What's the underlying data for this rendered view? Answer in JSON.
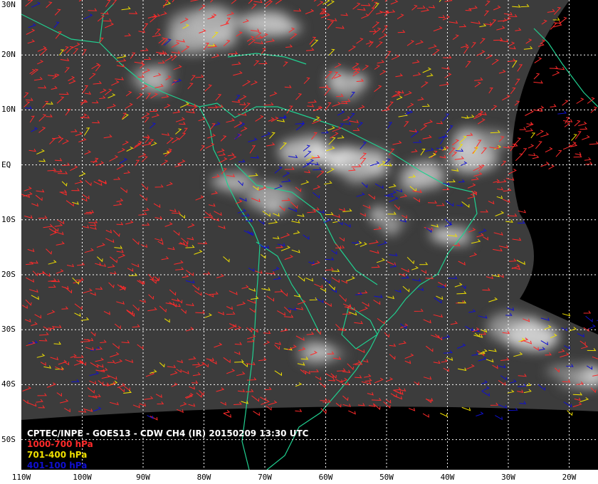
{
  "map": {
    "product": "CPTEC/INPE - GOES13 - CDW CH4 (IR) 20150209 13:30 UTC",
    "latitude_labels": [
      "30N",
      "20N",
      "10N",
      "EQ",
      "10S",
      "20S",
      "30S",
      "40S",
      "50S"
    ],
    "longitude_labels": [
      "110W",
      "100W",
      "90W",
      "80W",
      "70W",
      "60W",
      "50W",
      "40W",
      "30W",
      "20W"
    ],
    "latitude_values": [
      30,
      20,
      10,
      0,
      -10,
      -20,
      -30,
      -40,
      -50
    ],
    "longitude_values": [
      -110,
      -100,
      -90,
      -80,
      -70,
      -60,
      -50,
      -40,
      -30,
      -20
    ],
    "legend": [
      {
        "label": "1000-700 hPa",
        "color": "#ff2a2a"
      },
      {
        "label": "701-400 hPa",
        "color": "#f0e000"
      },
      {
        "label": "401-100 hPa",
        "color": "#1010d0"
      }
    ],
    "colors": {
      "coastline": "#20d090",
      "grid": "#ffffff",
      "space": "#000000",
      "cloud_dark": "#3a3a3a",
      "cloud_bright": "#e0e0e0"
    }
  }
}
